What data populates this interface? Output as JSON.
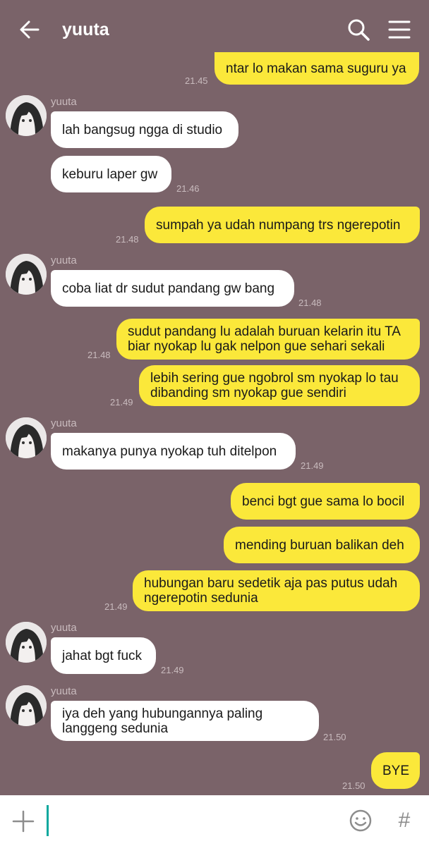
{
  "header": {
    "title": "yuuta",
    "back_icon": "arrow-left-icon",
    "search_icon": "search-icon",
    "menu_icon": "hamburger-menu-icon"
  },
  "colors": {
    "background": "#7a6369",
    "incoming_bubble": "#ffffff",
    "outgoing_bubble": "#fbe83a",
    "cursor": "#0aa89e"
  },
  "messages": [
    {
      "direction": "out",
      "text": "ntar lo makan sama suguru ya",
      "time": "21.45"
    },
    {
      "direction": "in",
      "sender": "yuuta",
      "text": "lah bangsug ngga di studio"
    },
    {
      "direction": "in",
      "text": "keburu laper gw",
      "time": "21.46"
    },
    {
      "direction": "out",
      "text": "sumpah ya udah numpang trs ngerepotin",
      "time": "21.48"
    },
    {
      "direction": "in",
      "sender": "yuuta",
      "text": "coba liat dr sudut pandang gw bang",
      "time": "21.48"
    },
    {
      "direction": "out",
      "text": "sudut pandang lu adalah buruan kelarin itu TA\nbiar nyokap lu gak nelpon gue sehari sekali",
      "time": "21.48"
    },
    {
      "direction": "out",
      "text": "lebih sering gue ngobrol sm nyokap lo tau\ndibanding sm nyokap gue sendiri",
      "time": "21.49"
    },
    {
      "direction": "in",
      "sender": "yuuta",
      "text": "makanya punya nyokap tuh ditelpon",
      "time": "21.49"
    },
    {
      "direction": "out",
      "text": "benci bgt gue sama lo bocil"
    },
    {
      "direction": "out",
      "text": "mending buruan balikan deh"
    },
    {
      "direction": "out",
      "text": "hubungan baru sedetik aja pas putus udah\nngerepotin sedunia",
      "time": "21.49"
    },
    {
      "direction": "in",
      "sender": "yuuta",
      "text": "jahat bgt fuck",
      "time": "21.49"
    },
    {
      "direction": "in",
      "sender": "yuuta",
      "text": "iya deh yang hubungannya paling\nlanggeng sedunia",
      "time": "21.50"
    },
    {
      "direction": "out",
      "text": "BYE",
      "time": "21.50"
    }
  ],
  "composer": {
    "value": "",
    "plus_icon": "plus-icon",
    "emoji_icon": "smiley-icon",
    "hashtag_label": "#"
  }
}
